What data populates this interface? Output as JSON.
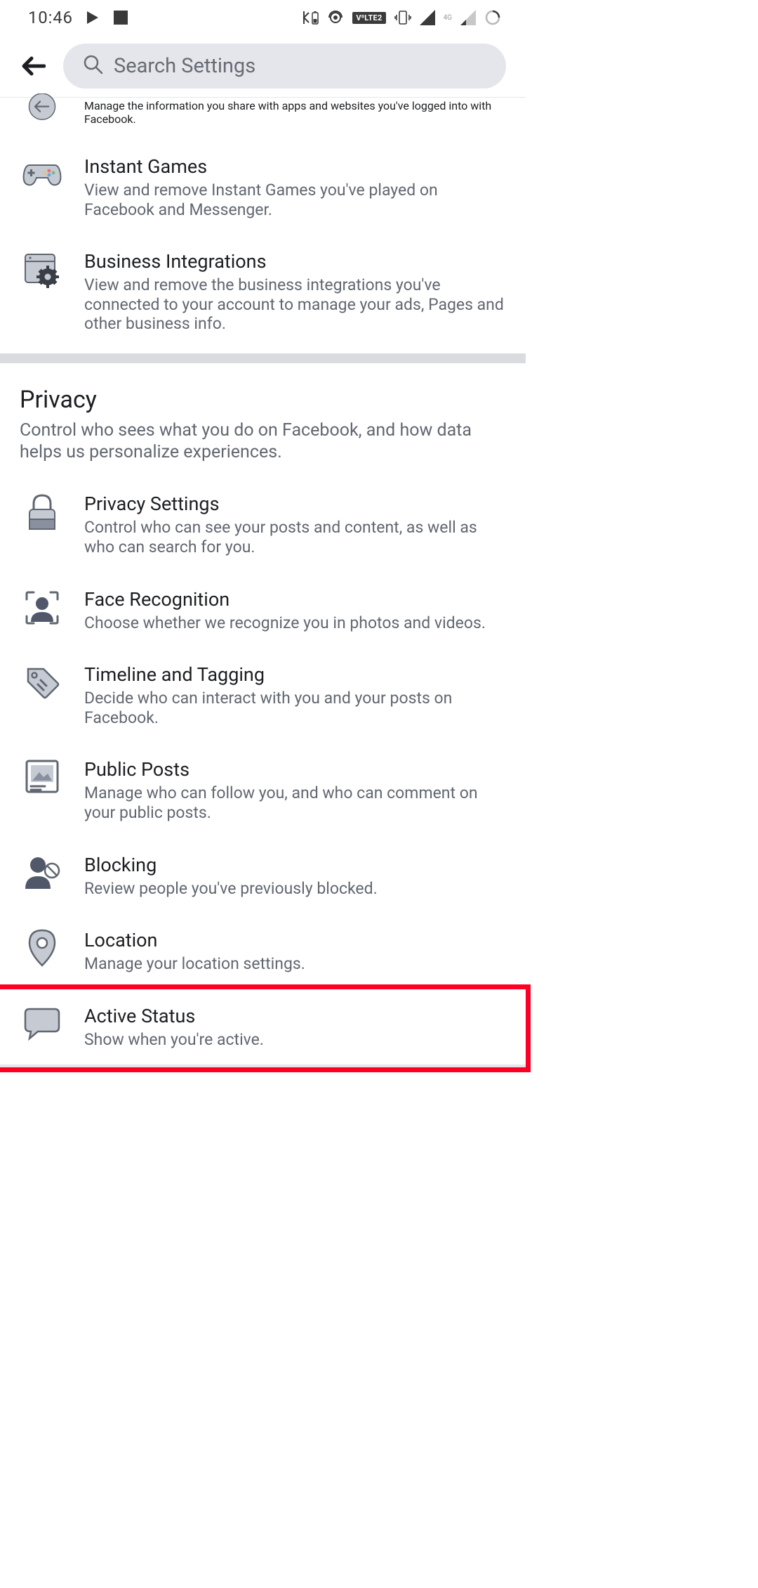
{
  "status": {
    "time": "10:46",
    "network_label": "4G",
    "volte_label": "V⁰LTE2"
  },
  "search": {
    "placeholder": "Search Settings"
  },
  "partial_item": {
    "desc": "Manage the information you share with apps and websites you've logged into with Facebook."
  },
  "top_section_items": [
    {
      "title": "Instant Games",
      "desc": "View and remove Instant Games you've played on Facebook and Messenger."
    },
    {
      "title": "Business Integrations",
      "desc": "View and remove the business integrations you've connected to your account to manage your ads, Pages and other business info."
    }
  ],
  "privacy_section": {
    "title": "Privacy",
    "desc": "Control who sees what you do on Facebook, and how data helps us personalize experiences.",
    "items": [
      {
        "title": "Privacy Settings",
        "desc": "Control who can see your posts and content, as well as who can search for you."
      },
      {
        "title": "Face Recognition",
        "desc": "Choose whether we recognize you in photos and videos."
      },
      {
        "title": "Timeline and Tagging",
        "desc": "Decide who can interact with you and your posts on Facebook."
      },
      {
        "title": "Public Posts",
        "desc": "Manage who can follow you, and who can comment on your public posts."
      },
      {
        "title": "Blocking",
        "desc": "Review people you've previously blocked."
      },
      {
        "title": "Location",
        "desc": "Manage your location settings."
      },
      {
        "title": "Active Status",
        "desc": "Show when you're active."
      }
    ]
  }
}
